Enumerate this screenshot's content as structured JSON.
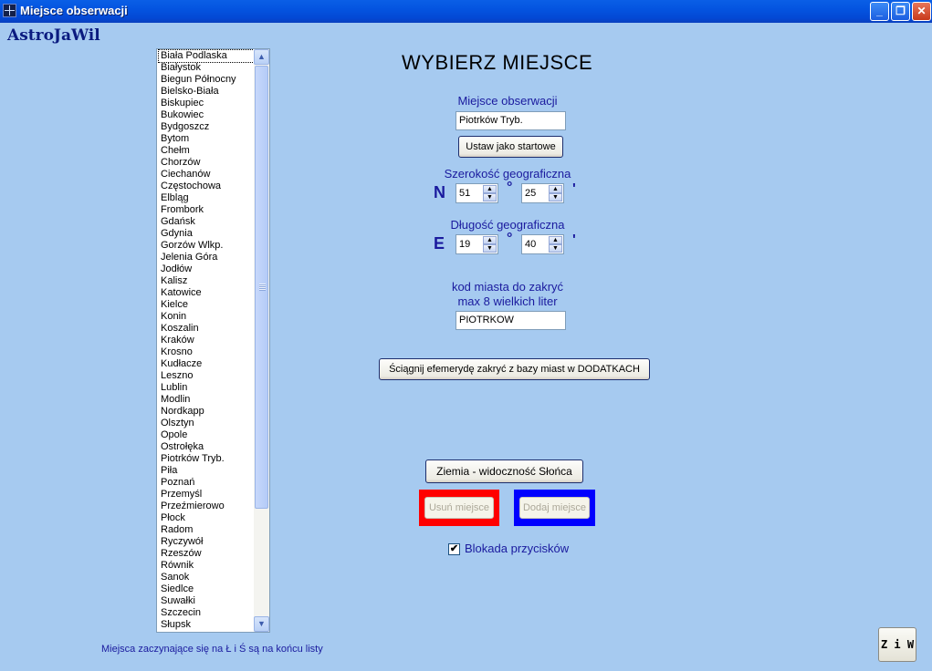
{
  "window": {
    "title": "Miejsce obserwacji",
    "brand": "AstroJaWil",
    "controls": {
      "minimize": "_",
      "maximize": "❐",
      "close": "✕"
    }
  },
  "places_list": {
    "selected": "Biała Podlaska",
    "items": [
      "Biała Podlaska",
      "Białystok",
      "Biegun Północny",
      "Bielsko-Biała",
      "Biskupiec",
      "Bukowiec",
      "Bydgoszcz",
      "Bytom",
      "Chełm",
      "Chorzów",
      "Ciechanów",
      "Częstochowa",
      "Elbląg",
      "Frombork",
      "Gdańsk",
      "Gdynia",
      "Gorzów Wlkp.",
      "Jelenia Góra",
      "Jodłów",
      "Kalisz",
      "Katowice",
      "Kielce",
      "Konin",
      "Koszalin",
      "Kraków",
      "Krosno",
      "Kudłacze",
      "Leszno",
      "Lublin",
      "Modlin",
      "Nordkapp",
      "Olsztyn",
      "Opole",
      "Ostrołęka",
      "Piotrków Tryb.",
      "Piła",
      "Poznań",
      "Przemyśl",
      "Przeźmierowo",
      "Płock",
      "Radom",
      "Ryczywół",
      "Rzeszów",
      "Równik",
      "Sanok",
      "Siedlce",
      "Suwałki",
      "Szczecin",
      "Słupsk"
    ]
  },
  "form": {
    "heading": "WYBIERZ  MIEJSCE",
    "place_label": "Miejsce obserwacji",
    "place_value": "Piotrków Tryb.",
    "set_start_button": "Ustaw jako startowe",
    "latitude_label": "Szerokość geograficzna",
    "latitude_hemisphere": "N",
    "latitude_degrees": "51",
    "latitude_minutes": "25",
    "longitude_label": "Długość geograficzna",
    "longitude_hemisphere": "E",
    "longitude_degrees": "19",
    "longitude_minutes": "40",
    "degree_symbol": "°",
    "minute_symbol": "'",
    "city_code_label_1": "kod miasta do zakryć",
    "city_code_label_2": "max 8 wielkich liter",
    "city_code_value": "PIOTRKOW",
    "download_button": "Ściągnij efemerydę zakryć z bazy miast w DODATKACH",
    "earth_button": "Ziemia - widoczność Słońca",
    "remove_button": "Usuń miejsce",
    "add_button": "Dodaj miejsce",
    "lock_label": "Blokada przycisków",
    "lock_checked": "✔"
  },
  "footer": {
    "note": "Miejsca zaczynające się na  Ł i Ś  są na końcu listy",
    "ziw_button": "Z i W"
  },
  "colors": {
    "background": "#a6caf0",
    "label": "#1a1a9e",
    "remove_frame": "#ff0000",
    "add_frame": "#0000ff"
  }
}
